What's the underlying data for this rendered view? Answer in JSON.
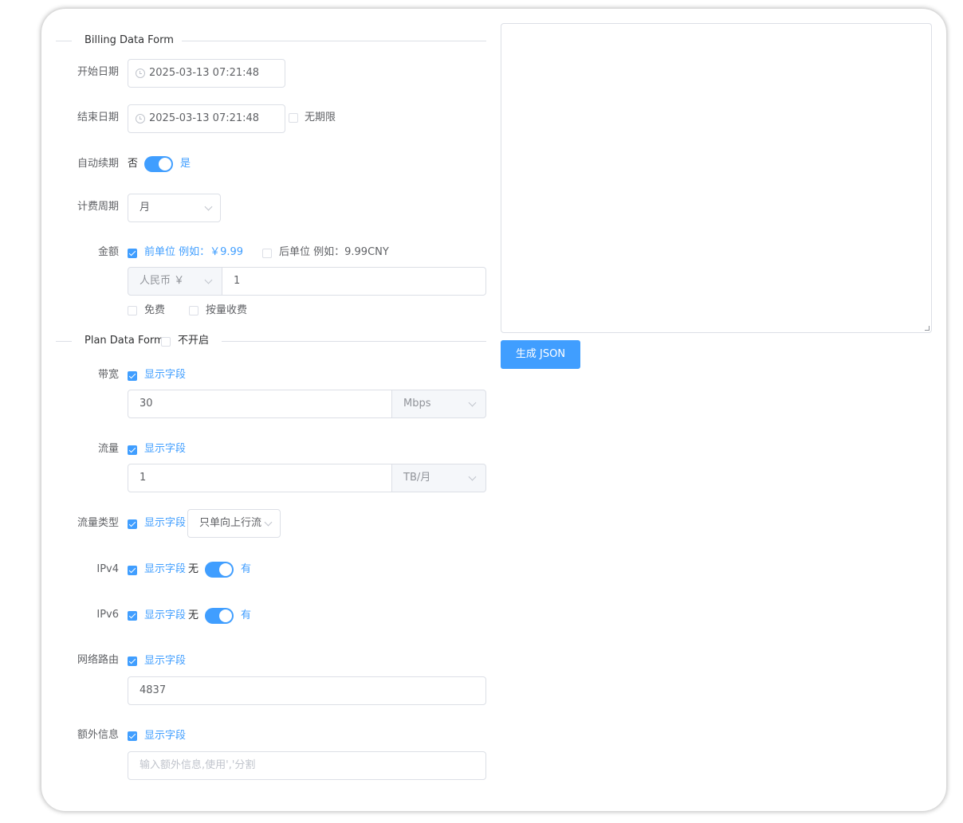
{
  "billing": {
    "title": "Billing Data Form",
    "start_date": {
      "label": "开始日期",
      "value": "2025-03-13 07:21:48"
    },
    "end_date": {
      "label": "结束日期",
      "value": "2025-03-13 07:21:48",
      "unlimited_label": "无期限"
    },
    "auto_renew": {
      "label": "自动续期",
      "off_text": "否",
      "on_text": "是"
    },
    "cycle": {
      "label": "计费周期",
      "value": "月"
    },
    "amount": {
      "label": "金额",
      "prefix_option": "前单位 例如：￥9.99",
      "suffix_option": "后单位 例如：9.99CNY",
      "currency": "人民币 ￥",
      "value": "1",
      "free_label": "免费",
      "usage_label": "按量收费"
    }
  },
  "plan": {
    "title": "Plan Data Form",
    "disable_label": "不开启",
    "show_field": "显示字段",
    "bandwidth": {
      "label": "带宽",
      "value": "30",
      "unit": "Mbps"
    },
    "traffic": {
      "label": "流量",
      "value": "1",
      "unit": "TB/月"
    },
    "traffic_type": {
      "label": "流量类型",
      "value": "只单向上行流"
    },
    "ipv4": {
      "label": "IPv4",
      "off_text": "无",
      "on_text": "有"
    },
    "ipv6": {
      "label": "IPv6",
      "off_text": "无",
      "on_text": "有"
    },
    "route": {
      "label": "网络路由",
      "value": "4837"
    },
    "extra": {
      "label": "额外信息",
      "placeholder": "输入额外信息,使用','分割"
    }
  },
  "output": {
    "textarea_value": "",
    "generate_button": "生成 JSON"
  },
  "colors": {
    "accent": "#409eff",
    "border": "#dcdfe6"
  }
}
